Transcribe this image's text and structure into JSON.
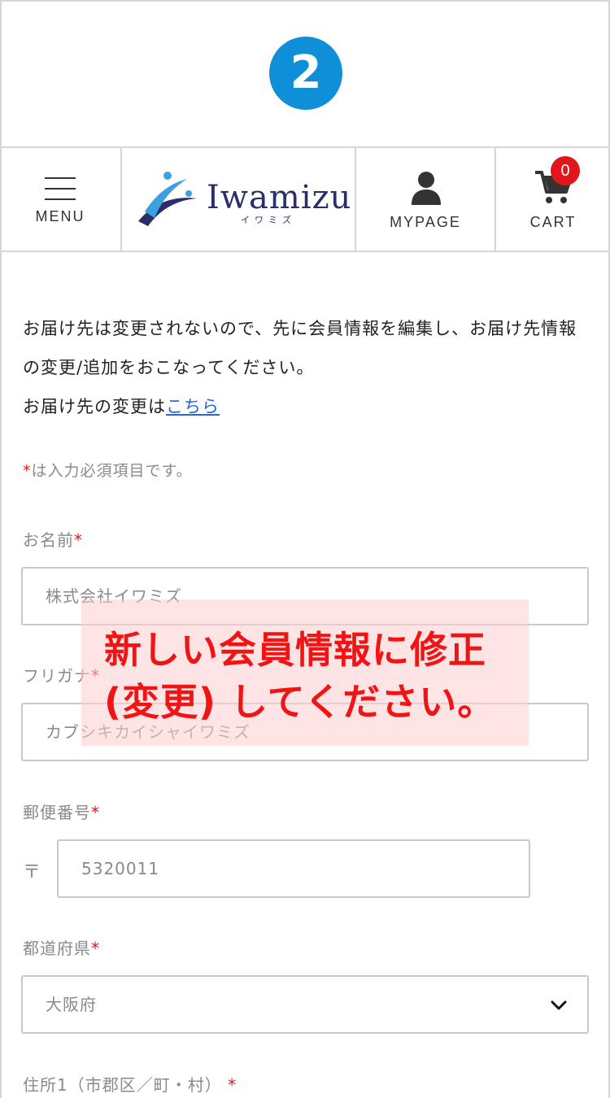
{
  "step": {
    "number": "2"
  },
  "header": {
    "menu_label": "MENU",
    "logo_text": "Iwamizu",
    "logo_sub": "イワミズ",
    "mypage_label": "MYPAGE",
    "cart_label": "CART",
    "cart_count": "0",
    "icons": [
      "menu-icon",
      "iwamizu-logo",
      "person-icon",
      "cart-icon"
    ]
  },
  "intro": {
    "line1": "お届け先は変更されないので、先に会員情報を編集し、お届け先情報の変更/追加をおこなってください。",
    "line2_prefix": "お届け先の変更は",
    "line2_link": "こちら"
  },
  "required_note": {
    "mark": "*",
    "text": "は入力必須項目です。"
  },
  "form": {
    "name": {
      "label": "お名前",
      "value": "株式会社イワミズ"
    },
    "kana": {
      "label": "フリガナ",
      "value": "カブシキカイシャイワミズ"
    },
    "postal": {
      "label": "郵便番号",
      "mark": "〒",
      "value": "5320011"
    },
    "prefecture": {
      "label": "都道府県",
      "value": "大阪府"
    },
    "address1": {
      "label": "住所1（市郡区／町・村）"
    },
    "required_mark": "*"
  },
  "overlay": {
    "line1": "新しい会員情報に修正",
    "line2": "(変更) してください。"
  },
  "colors": {
    "accent_blue": "#0f8fd8",
    "required_red": "#e0161b",
    "link_blue": "#2468d8",
    "logo_navy": "#2a2f6b"
  }
}
